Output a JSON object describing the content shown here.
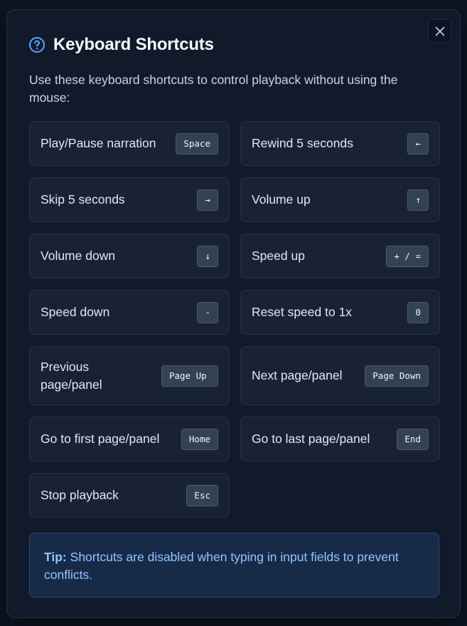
{
  "dialog": {
    "title": "Keyboard Shortcuts",
    "intro": "Use these keyboard shortcuts to control playback without using the mouse:",
    "close_icon": "close-icon",
    "help_icon": "question-circle-icon"
  },
  "shortcuts": [
    {
      "label": "Play/Pause narration",
      "key": "Space"
    },
    {
      "label": "Rewind 5 seconds",
      "key": "←"
    },
    {
      "label": "Skip 5 seconds",
      "key": "→"
    },
    {
      "label": "Volume up",
      "key": "↑"
    },
    {
      "label": "Volume down",
      "key": "↓"
    },
    {
      "label": "Speed up",
      "key": "+ / ="
    },
    {
      "label": "Speed down",
      "key": "-"
    },
    {
      "label": "Reset speed to 1x",
      "key": "0"
    },
    {
      "label": "Previous page/panel",
      "key": "Page Up"
    },
    {
      "label": "Next page/panel",
      "key": "Page Down"
    },
    {
      "label": "Go to first page/panel",
      "key": "Home"
    },
    {
      "label": "Go to last page/panel",
      "key": "End"
    },
    {
      "label": "Stop playback",
      "key": "Esc"
    }
  ],
  "tip": {
    "label": "Tip:",
    "text": "Shortcuts are disabled when typing in input fields to prevent conflicts."
  },
  "colors": {
    "accent": "#60a5fa",
    "tip_text": "#93c5fd"
  }
}
